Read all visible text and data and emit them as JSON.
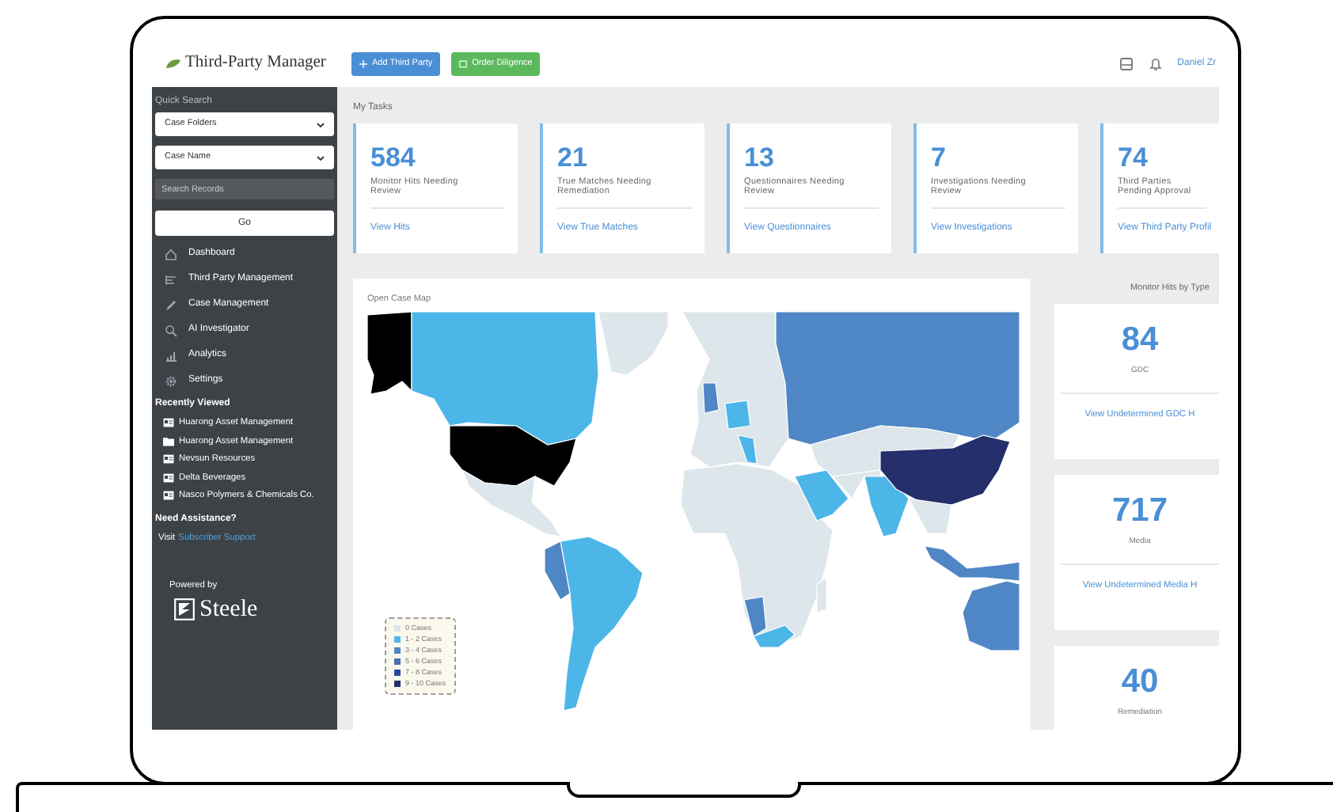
{
  "header": {
    "logo": "Third-Party Manager",
    "buttons": [
      {
        "label": "Add Third Party",
        "kind": "add"
      },
      {
        "label": "Order Diligence",
        "kind": "order"
      }
    ],
    "user": "Daniel Zr"
  },
  "sidebar": {
    "quick_search_label": "Quick Search",
    "dropdowns": [
      "Case Folders",
      "Case Name"
    ],
    "search": {
      "placeholder": "Search Records"
    },
    "go_button": "Go",
    "nav": [
      {
        "label": "Dashboard",
        "kind": "home"
      },
      {
        "label": "Third Party Management",
        "kind": "list"
      },
      {
        "label": "Case Management",
        "kind": "pencil"
      },
      {
        "label": "AI Investigator",
        "kind": "search"
      },
      {
        "label": "Analytics",
        "kind": "chart"
      },
      {
        "label": "Settings",
        "kind": "gear"
      }
    ],
    "recently_viewed": {
      "title": "Recently Viewed",
      "items": [
        {
          "label": "Huarong Asset Management",
          "kind": "record"
        },
        {
          "label": "Huarong Asset Management",
          "kind": "folder"
        },
        {
          "label": "Nevsun Resources",
          "kind": "record"
        },
        {
          "label": "Delta Beverages",
          "kind": "record"
        },
        {
          "label": "Nasco Polymers & Chemicals Co.",
          "kind": "record"
        }
      ]
    },
    "assistance": {
      "title": "Need Assistance?",
      "text": "Visit",
      "link": "Subscriber Support"
    },
    "powered_by": "Powered by",
    "brand": "Steele"
  },
  "my_tasks": {
    "title": "My Tasks",
    "cards": [
      {
        "count": "584",
        "label": "Monitor Hits Needing Review",
        "link": "View Hits"
      },
      {
        "count": "21",
        "label": "True Matches Needing Remediation",
        "link": "View True Matches"
      },
      {
        "count": "13",
        "label": "Questionnaires Needing Review",
        "link": "View Questionnaires"
      },
      {
        "count": "7",
        "label": "Investigations Needing Review",
        "link": "View Investigations"
      },
      {
        "count": "74",
        "label": "Third Parties Pending Approval",
        "link": "View Third Party Profil"
      }
    ]
  },
  "map": {
    "title": "Open Case Map",
    "legend": [
      {
        "label": "0 Cases",
        "color": "#dde6ea"
      },
      {
        "label": "1 - 2 Cases",
        "color": "#4db6e8"
      },
      {
        "label": "3 - 4 Cases",
        "color": "#4f86c6"
      },
      {
        "label": "5 - 6 Cases",
        "color": "#4a6fb5"
      },
      {
        "label": "7 - 8 Cases",
        "color": "#2a4aa0"
      },
      {
        "label": "9 - 10 Cases",
        "color": "#242f6b"
      }
    ]
  },
  "monitor_hits": {
    "title": "Monitor Hits by Type",
    "cards": [
      {
        "count": "84",
        "label": "GDC",
        "link": "View Undetermined GDC H"
      },
      {
        "count": "717",
        "label": "Media",
        "link": "View Undetermined Media H"
      },
      {
        "count": "40",
        "label": "Remediation"
      }
    ]
  }
}
